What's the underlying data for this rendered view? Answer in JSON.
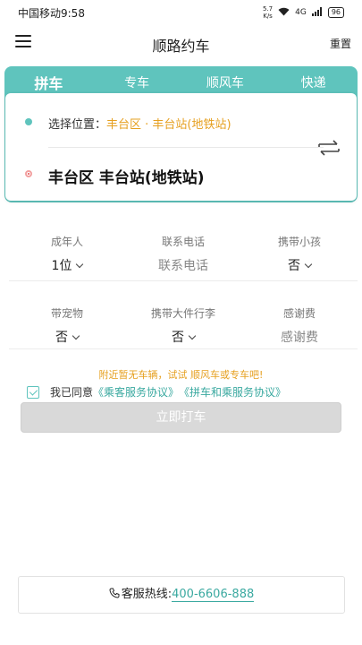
{
  "status_bar": {
    "carrier_time": "中国移动9:58",
    "net_speed_top": "5.7",
    "net_speed_bottom": "K/s",
    "signal": "4G",
    "battery": "96"
  },
  "nav": {
    "title": "顺路约车",
    "reset": "重置"
  },
  "tabs": [
    {
      "label": "拼车",
      "active": true
    },
    {
      "label": "专车",
      "active": false
    },
    {
      "label": "顺风车",
      "active": false
    },
    {
      "label": "快递",
      "active": false
    }
  ],
  "location": {
    "start_prefix": "选择位置：",
    "start_value": "丰台区 · 丰台站(地铁站)",
    "end_value": "丰台区 丰台站(地铁站)"
  },
  "form": {
    "row1": [
      {
        "label": "成年人",
        "value": "1位",
        "dropdown": true,
        "placeholder": false
      },
      {
        "label": "联系电话",
        "value": "联系电话",
        "dropdown": false,
        "placeholder": true
      },
      {
        "label": "携带小孩",
        "value": "否",
        "dropdown": true,
        "placeholder": false
      }
    ],
    "row2": [
      {
        "label": "带宠物",
        "value": "否",
        "dropdown": true,
        "placeholder": false
      },
      {
        "label": "携带大件行李",
        "value": "否",
        "dropdown": true,
        "placeholder": false
      },
      {
        "label": "感谢费",
        "value": "感谢费",
        "dropdown": false,
        "placeholder": true
      }
    ]
  },
  "notice": "附近暂无车辆，试试 顺风车或专车吧!",
  "agreement": {
    "prefix": "我已同意",
    "link1": "《乘客服务协议》",
    "link2": "《拼车和乘服务协议》",
    "checked": true
  },
  "submit_label": "立即打车",
  "hotline": {
    "label": "客服热线:",
    "number": "400-6606-888"
  },
  "colors": {
    "accent": "#5fc4bd",
    "warning": "#e6a020",
    "link": "#3aa9a0"
  }
}
